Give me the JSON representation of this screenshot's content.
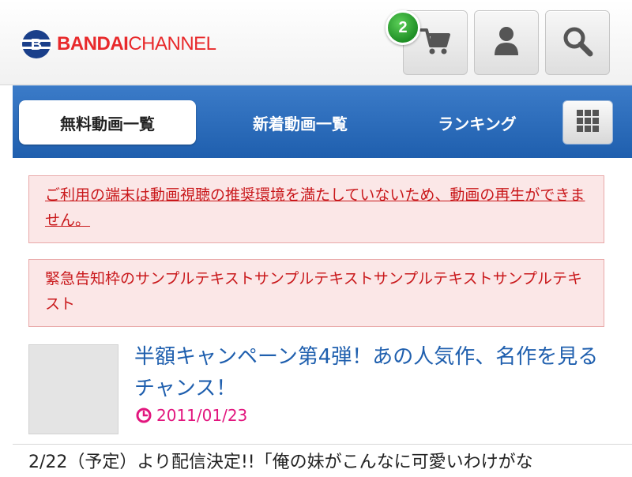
{
  "header": {
    "logo": {
      "text_part1": "BANDAI",
      "text_part2": "CHANNEL",
      "mark_letter": "B",
      "brand_color": "#e8292b"
    },
    "cart": {
      "icon": "cart-icon",
      "badge_count": "2"
    },
    "user": {
      "icon": "user-icon"
    },
    "search": {
      "icon": "search-icon"
    }
  },
  "nav": {
    "tabs": [
      {
        "label": "無料動画一覧",
        "active": true
      },
      {
        "label": "新着動画一覧",
        "active": false
      },
      {
        "label": "ランキング",
        "active": false
      }
    ],
    "menu_icon": "grid-menu-icon",
    "bar_color": "#2a6bb9"
  },
  "alerts": [
    {
      "text": "ご利用の端末は動画視聴の推奨環境を満たしていないため、動画の再生ができません。",
      "link": true
    },
    {
      "text": "緊急告知枠のサンプルテキストサンプルテキストサンプルテキストサンプルテキスト",
      "link": false
    }
  ],
  "news": [
    {
      "title": "半額キャンペーン第4弾！あの人気作、名作を見るチャンス！",
      "date": "2011/01/23",
      "date_icon": "clock-icon"
    },
    {
      "title": "2/22（予定）より配信決定!!「俺の妹がこんなに可愛いわけがな"
    }
  ],
  "colors": {
    "alert_text": "#c9181b",
    "alert_bg": "#fbe7e7",
    "news_title": "#1f5fae",
    "date": "#e2167e",
    "badge": "#2ea12f"
  }
}
